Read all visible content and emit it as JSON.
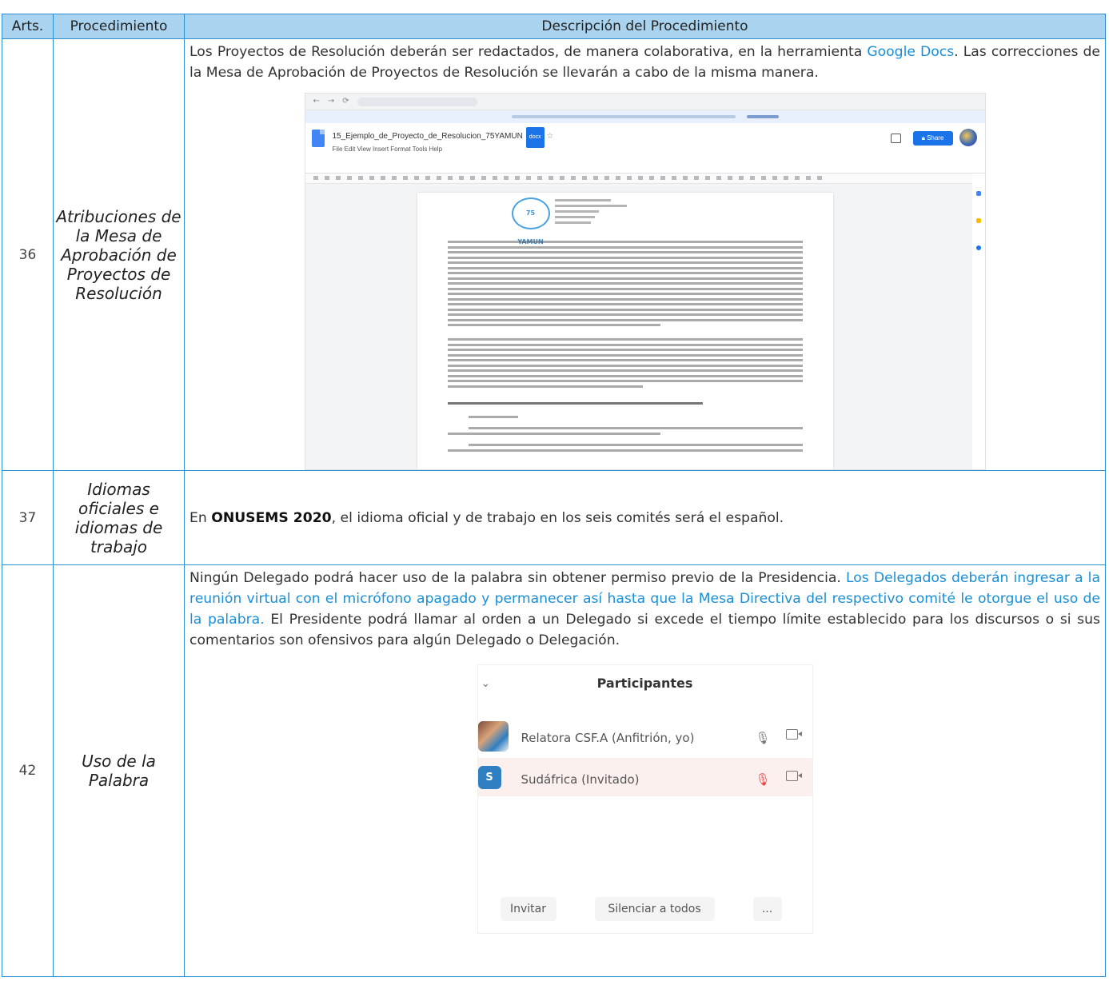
{
  "table": {
    "headers": {
      "arts": "Arts.",
      "procedimiento": "Procedimiento",
      "descripcion": "Descripción del Procedimiento"
    },
    "rows": [
      {
        "art": "36",
        "procedimiento": "Atribuciones de la Mesa de Aprobación de Proyectos de Resolución",
        "desc_a": "Los Proyectos de Resolución deberán ser redactados, de manera colaborativa, en la herramienta",
        "desc_link": "Google Docs",
        "desc_b": ". Las correcciones de la Mesa de Aprobación de Proyectos de Resolución se llevarán a cabo de la misma manera."
      },
      {
        "art": "37",
        "procedimiento": "Idiomas oficiales e idiomas de trabajo",
        "desc_a": "En",
        "desc_strong": "ONUSEMS 2020",
        "desc_b": ", el idioma oficial y de trabajo en los seis comités será el español."
      },
      {
        "art": "42",
        "procedimiento": "Uso de la Palabra",
        "desc_a": "Ningún Delegado podrá hacer uso de la palabra sin obtener permiso previo de la Presidencia.",
        "desc_hl": "Los Delegados deberán ingresar a la reunión virtual con el micrófono apagado y permanecer así hasta que la Mesa Directiva del respectivo comité le otorgue el uso de la palabra.",
        "desc_b": "El Presidente podrá llamar al orden a un Delegado si excede el tiempo límite establecido para los discursos o si sus comentarios son ofensivos para algún Delegado o Delegación."
      }
    ]
  },
  "gdoc": {
    "doc_title": "15_Ejemplo_de_Proyecto_de_Resolucion_75YAMUN",
    "menu": "File  Edit  View  Insert  Format  Tools  Help",
    "share_label": "Share",
    "logo_text": "75 YAMUN"
  },
  "zoom": {
    "title": "Participantes",
    "participants": [
      {
        "name": "Relatora CSF.A (Anfitrión, yo)",
        "mic": "on"
      },
      {
        "name": "Sudáfrica (Invitado)",
        "initial": "S",
        "mic": "off"
      }
    ],
    "buttons": {
      "invite": "Invitar",
      "mute_all": "Silenciar a todos",
      "more": "..."
    }
  },
  "colors": {
    "header_bg": "#a9d3ef",
    "border": "#2e8fd1",
    "accent": "#1a8fd6",
    "muted_mic": "#e04848"
  }
}
